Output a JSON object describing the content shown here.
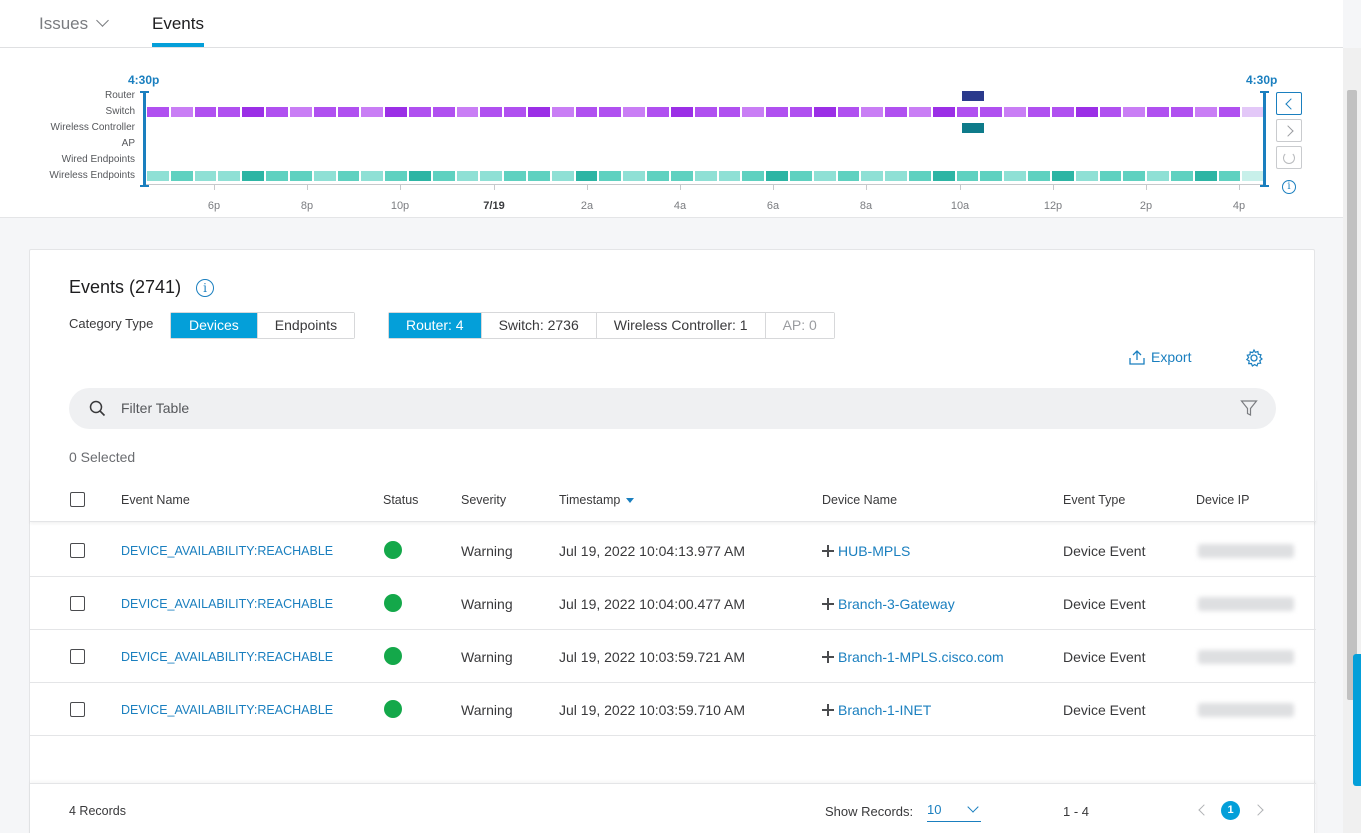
{
  "tabs": [
    {
      "label": "Issues",
      "has_dropdown": true
    },
    {
      "label": "Events",
      "active": true
    }
  ],
  "timeline": {
    "start_label": "4:30p",
    "end_label": "4:30p",
    "row_labels": [
      "Router",
      "Switch",
      "Wireless Controller",
      "AP",
      "Wired Endpoints",
      "Wireless Endpoints"
    ],
    "ticks": [
      "6p",
      "8p",
      "10p",
      "7/19",
      "2a",
      "4a",
      "6a",
      "8a",
      "10a",
      "12p",
      "2p",
      "4p"
    ],
    "colors": {
      "switch": [
        "#b050f0",
        "#c97ef5",
        "#9b2fe6"
      ],
      "endpoints": [
        "#5fd1c0",
        "#8fe0d5",
        "#2db5a4"
      ],
      "router": "#2b3a8c",
      "wireless_controller": "#0e7b8a"
    }
  },
  "card": {
    "title": "Events (2741)",
    "category_label": "Category Type",
    "category_buttons": [
      {
        "label": "Devices",
        "active": true
      },
      {
        "label": "Endpoints",
        "active": false
      }
    ],
    "filter_buttons": [
      {
        "label": "Router: 4",
        "active": true
      },
      {
        "label": "Switch: 2736",
        "active": false
      },
      {
        "label": "Wireless Controller: 1",
        "active": false
      },
      {
        "label": "AP: 0",
        "active": false,
        "muted": true
      }
    ],
    "export_label": "Export",
    "filter_placeholder": "Filter Table",
    "selected_text": "0 Selected"
  },
  "table": {
    "columns": [
      "Event Name",
      "Status",
      "Severity",
      "Timestamp",
      "Device Name",
      "Event Type",
      "Device IP"
    ],
    "rows": [
      {
        "event_name": "DEVICE_AVAILABILITY:REACHABLE",
        "status": "green",
        "severity": "Warning",
        "timestamp": "Jul 19, 2022 10:04:13.977 AM",
        "device_name": "HUB-MPLS",
        "event_type": "Device Event"
      },
      {
        "event_name": "DEVICE_AVAILABILITY:REACHABLE",
        "status": "green",
        "severity": "Warning",
        "timestamp": "Jul 19, 2022 10:04:00.477 AM",
        "device_name": "Branch-3-Gateway",
        "event_type": "Device Event"
      },
      {
        "event_name": "DEVICE_AVAILABILITY:REACHABLE",
        "status": "green",
        "severity": "Warning",
        "timestamp": "Jul 19, 2022 10:03:59.721 AM",
        "device_name": "Branch-1-MPLS.cisco.com",
        "event_type": "Device Event"
      },
      {
        "event_name": "DEVICE_AVAILABILITY:REACHABLE",
        "status": "green",
        "severity": "Warning",
        "timestamp": "Jul 19, 2022 10:03:59.710 AM",
        "device_name": "Branch-1-INET",
        "event_type": "Device Event"
      }
    ]
  },
  "footer": {
    "records": "4 Records",
    "show_records_label": "Show Records:",
    "show_records_value": "10",
    "range": "1 - 4",
    "current_page": "1"
  }
}
